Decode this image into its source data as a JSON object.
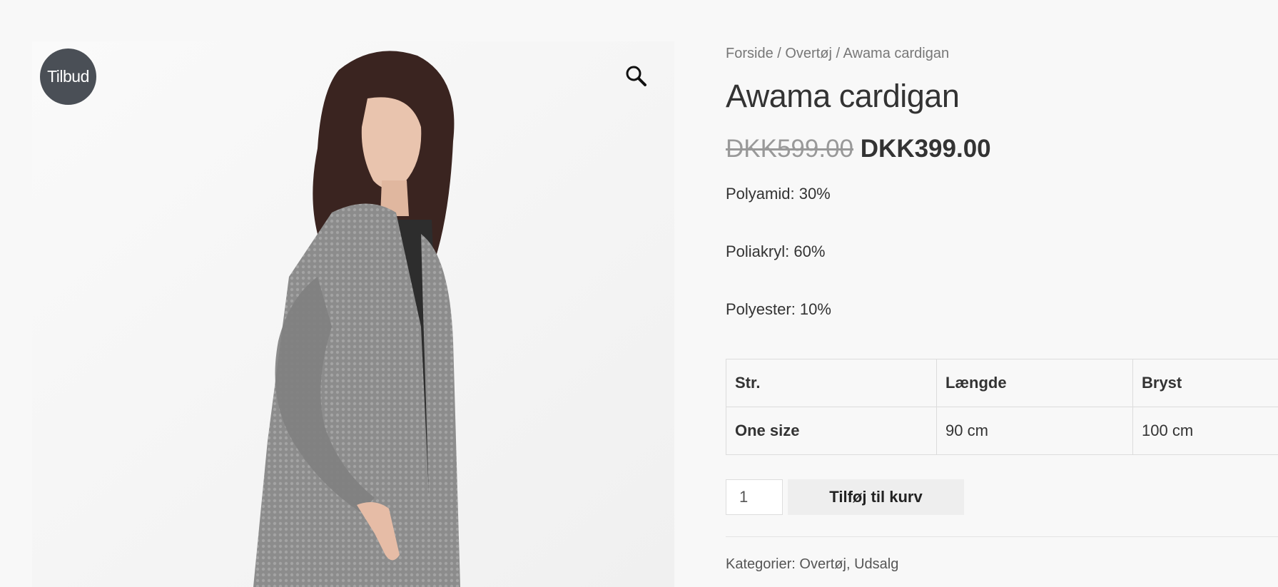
{
  "badge": {
    "label": "Tilbud"
  },
  "breadcrumb": {
    "home": "Forside",
    "category": "Overtøj",
    "current": "Awama cardigan",
    "separator": " / "
  },
  "product": {
    "title": "Awama cardigan",
    "price_old": "DKK599.00",
    "price_new": "DKK399.00",
    "description": [
      "Polyamid: 30%",
      "Poliakryl: 60%",
      "Polyester: 10%"
    ]
  },
  "size_table": {
    "headers": [
      "Str.",
      "Længde",
      "Bryst"
    ],
    "rows": [
      [
        "One size",
        "90 cm",
        "100 cm"
      ]
    ]
  },
  "cart": {
    "quantity": "1",
    "add_label": "Tilføj til kurv"
  },
  "meta": {
    "label": "Kategorier: ",
    "cat1": "Overtøj",
    "sep": ", ",
    "cat2": "Udsalg"
  },
  "icons": {
    "zoom": "magnifier-icon"
  }
}
